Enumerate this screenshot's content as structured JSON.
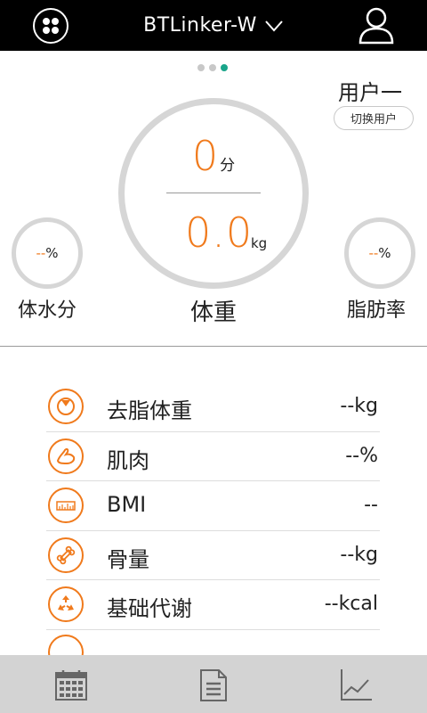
{
  "header": {
    "title": "BTLinker-W",
    "menu_icon": "grid-dots-icon",
    "dropdown_icon": "chevron-down-icon",
    "profile_icon": "user-icon"
  },
  "pager": {
    "total": 3,
    "active": 3
  },
  "user": {
    "name": "用户一",
    "switch_label": "切换用户"
  },
  "main_gauge": {
    "score": "0",
    "score_unit": "分",
    "weight": "0.0",
    "weight_unit": "kg",
    "label": "体重"
  },
  "left_gauge": {
    "value": "--",
    "unit": "%",
    "label": "体水分"
  },
  "right_gauge": {
    "value": "--",
    "unit": "%",
    "label": "脂肪率"
  },
  "metrics": [
    {
      "name": "去脂体重",
      "value": "--kg",
      "icon": "lean-mass-icon"
    },
    {
      "name": "肌肉",
      "value": "--%",
      "icon": "muscle-arm-icon"
    },
    {
      "name": "BMI",
      "value": "--",
      "icon": "bmi-ruler-icon"
    },
    {
      "name": "骨量",
      "value": "--kg",
      "icon": "bone-icon"
    },
    {
      "name": "基础代谢",
      "value": "--kcal",
      "icon": "metabolism-cycle-icon"
    }
  ],
  "tabbar": {
    "tabs": [
      "calendar-icon",
      "report-document-icon",
      "trend-chart-icon"
    ]
  },
  "colors": {
    "accent": "#f07a1c",
    "pager_active": "#1aa58a",
    "ring": "#d6d6d6",
    "header_bg": "#000000",
    "tabbar_bg": "#d3d3d3"
  }
}
